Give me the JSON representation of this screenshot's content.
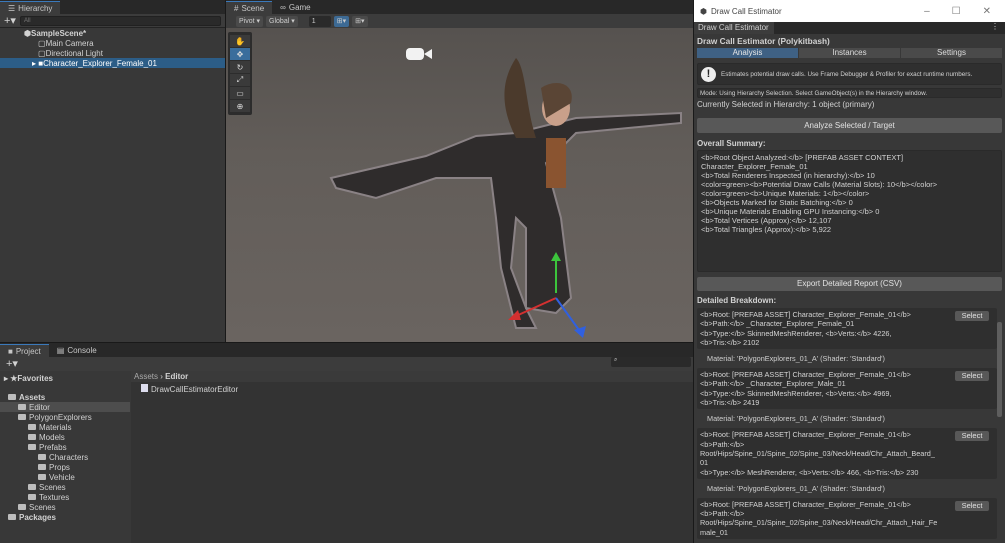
{
  "hierarchy": {
    "tab": "Hierarchy",
    "search_placeholder": "All",
    "scene": "SampleScene*",
    "items": [
      "Main Camera",
      "Directional Light",
      "Character_Explorer_Female_01"
    ]
  },
  "scene": {
    "tabs": [
      "Scene",
      "Game"
    ],
    "pivot": "Pivot",
    "global": "Global",
    "grid_value": "1"
  },
  "project": {
    "tabs": [
      "Project",
      "Console"
    ],
    "favorites": "Favorites",
    "tree": [
      {
        "label": "Assets",
        "depth": 0,
        "bold": true
      },
      {
        "label": "Editor",
        "depth": 1,
        "selected": true
      },
      {
        "label": "PolygonExplorers",
        "depth": 1
      },
      {
        "label": "Materials",
        "depth": 2
      },
      {
        "label": "Models",
        "depth": 2
      },
      {
        "label": "Prefabs",
        "depth": 2
      },
      {
        "label": "Characters",
        "depth": 3
      },
      {
        "label": "Props",
        "depth": 3
      },
      {
        "label": "Vehicle",
        "depth": 3
      },
      {
        "label": "Scenes",
        "depth": 2
      },
      {
        "label": "Textures",
        "depth": 2
      },
      {
        "label": "Scenes",
        "depth": 1
      },
      {
        "label": "Packages",
        "depth": 0,
        "bold": true
      }
    ],
    "breadcrumb": [
      "Assets",
      "Editor"
    ],
    "file": "DrawCallEstimatorEditor"
  },
  "estimator": {
    "window_title": "Draw Call Estimator",
    "tab": "Draw Call Estimator",
    "heading": "Draw Call Estimator (Polykitbash)",
    "tabs": [
      "Analysis",
      "Instances",
      "Settings"
    ],
    "info": "Estimates potential draw calls. Use Frame Debugger & Profiler for exact runtime numbers.",
    "mode": "Mode: Using Hierarchy Selection. Select GameObject(s) in the Hierarchy window.",
    "selected": "Currently Selected in Hierarchy: 1 object (primary)",
    "analyze_button": "Analyze Selected / Target",
    "summary_label": "Overall Summary:",
    "summary_lines": [
      "<b>Root Object Analyzed:</b> [PREFAB ASSET CONTEXT]",
      "Character_Explorer_Female_01",
      "<b>Total Renderers Inspected (in hierarchy):</b> 10",
      "<color=green><b>Potential Draw Calls (Material Slots): 10</b></color>",
      "<color=green><b>Unique Materials: 1</b></color>",
      "<b>Objects Marked for Static Batching:</b> 0",
      "<b>Unique Materials Enabling GPU Instancing:</b> 0",
      "<b>Total Vertices (Approx):</b> 12,107",
      "<b>Total Triangles (Approx):</b> 5,922"
    ],
    "export_button": "Export Detailed Report (CSV)",
    "breakdown_label": "Detailed Breakdown:",
    "select_label": "Select",
    "entries": [
      {
        "lines": [
          "<b>Root: [PREFAB ASSET] Character_Explorer_Female_01</b>",
          "<b>Path:</b> _Character_Explorer_Female_01",
          "<b>Type:</b> SkinnedMeshRenderer, <b>Verts:</b> 4226,",
          "<b>Tris:</b> 2102"
        ],
        "material": "Material: 'PolygonExplorers_01_A' (Shader: 'Standard')"
      },
      {
        "lines": [
          "<b>Root: [PREFAB ASSET] Character_Explorer_Female_01</b>",
          "<b>Path:</b> _Character_Explorer_Male_01",
          "<b>Type:</b> SkinnedMeshRenderer, <b>Verts:</b> 4969,",
          "<b>Tris:</b> 2419"
        ],
        "material": "Material: 'PolygonExplorers_01_A' (Shader: 'Standard')"
      },
      {
        "lines": [
          "<b>Root: [PREFAB ASSET] Character_Explorer_Female_01</b>",
          "<b>Path:</b>",
          "Root/Hips/Spine_01/Spine_02/Spine_03/Neck/Head/Chr_Attach_Beard_",
          "01",
          "<b>Type:</b> MeshRenderer, <b>Verts:</b> 466, <b>Tris:</b> 230"
        ],
        "material": "Material: 'PolygonExplorers_01_A' (Shader: 'Standard')"
      },
      {
        "lines": [
          "<b>Root: [PREFAB ASSET] Character_Explorer_Female_01</b>",
          "<b>Path:</b>",
          "Root/Hips/Spine_01/Spine_02/Spine_03/Neck/Head/Chr_Attach_Hair_Fe",
          "male_01"
        ]
      }
    ]
  }
}
